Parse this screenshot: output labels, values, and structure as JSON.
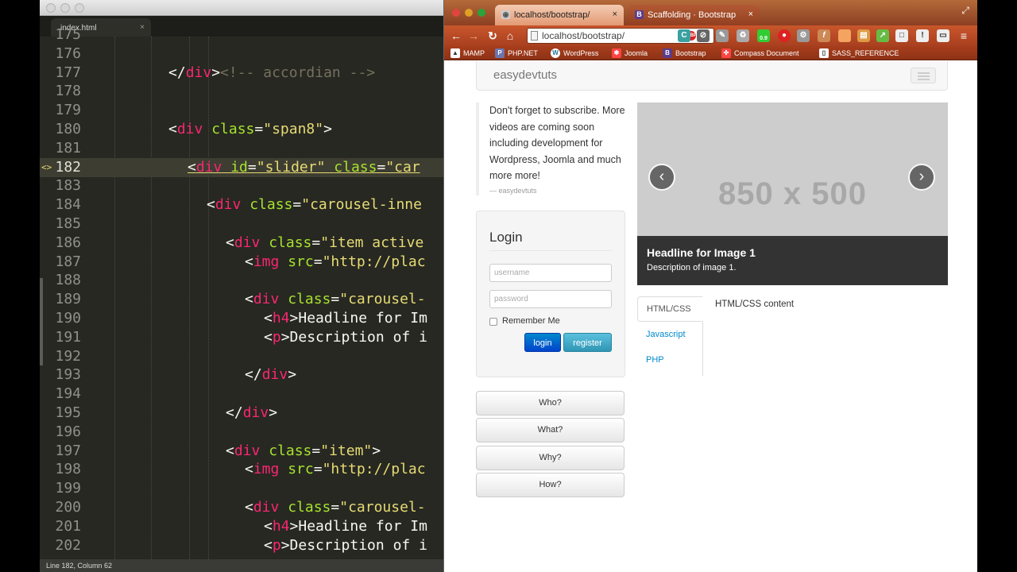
{
  "editor": {
    "tab_label": "index.html",
    "tab_close": "×",
    "status": "Line 182, Column 62",
    "lines": [
      {
        "n": "175",
        "code": ""
      },
      {
        "n": "176",
        "code": ""
      },
      {
        "n": "177",
        "code": "</div><!-- accordian -->"
      },
      {
        "n": "178",
        "code": ""
      },
      {
        "n": "179",
        "code": ""
      },
      {
        "n": "180",
        "code": "<div class=\"span8\">"
      },
      {
        "n": "181",
        "code": ""
      },
      {
        "n": "182",
        "code": "<div id=\"slider\" class=\"car"
      },
      {
        "n": "183",
        "code": ""
      },
      {
        "n": "184",
        "code": "<div class=\"carousel-inne"
      },
      {
        "n": "185",
        "code": ""
      },
      {
        "n": "186",
        "code": "<div class=\"item active"
      },
      {
        "n": "187",
        "code": "<img src=\"http://plac"
      },
      {
        "n": "188",
        "code": ""
      },
      {
        "n": "189",
        "code": "<div class=\"carousel-"
      },
      {
        "n": "190",
        "code": "<h4>Headline for Im"
      },
      {
        "n": "191",
        "code": "<p>Description of i"
      },
      {
        "n": "192",
        "code": ""
      },
      {
        "n": "193",
        "code": "</div>"
      },
      {
        "n": "194",
        "code": ""
      },
      {
        "n": "195",
        "code": "</div>"
      },
      {
        "n": "196",
        "code": ""
      },
      {
        "n": "197",
        "code": "<div class=\"item\">"
      },
      {
        "n": "198",
        "code": "<img src=\"http://plac"
      },
      {
        "n": "199",
        "code": ""
      },
      {
        "n": "200",
        "code": "<div class=\"carousel-"
      },
      {
        "n": "201",
        "code": "<h4>Headline for Im"
      },
      {
        "n": "202",
        "code": "<p>Description of i"
      }
    ]
  },
  "browser": {
    "tabs": [
      {
        "label": "localhost/bootstrap/",
        "close": "×"
      },
      {
        "label": "Scaffolding · Bootstrap",
        "close": "×"
      }
    ],
    "address": "localhost/bootstrap/",
    "bookmarks": [
      "MAMP",
      "PHP.NET",
      "WordPress",
      "Joomla",
      "Bootstrap",
      "Compass Document",
      "SASS_REFERENCE"
    ],
    "extension_badge": "0.9"
  },
  "page": {
    "brand": "easydevtuts",
    "quote": {
      "text": "Don't forget to subscribe. More videos are coming soon including development for Wordpress, Joomla and much more more!",
      "source": "— easydevtuts"
    },
    "login": {
      "title": "Login",
      "username_placeholder": "username",
      "password_placeholder": "password",
      "remember_label": "Remember Me",
      "login_button": "login",
      "register_button": "register"
    },
    "accordion": [
      "Who?",
      "What?",
      "Why?",
      "How?"
    ],
    "carousel": {
      "placeholder": "850 x 500",
      "prev": "‹",
      "next": "›",
      "headline": "Headline for Image 1",
      "description": "Description of image 1."
    },
    "tabs": [
      "HTML/CSS",
      "Javascript",
      "PHP"
    ],
    "tab_content": "HTML/CSS content"
  }
}
